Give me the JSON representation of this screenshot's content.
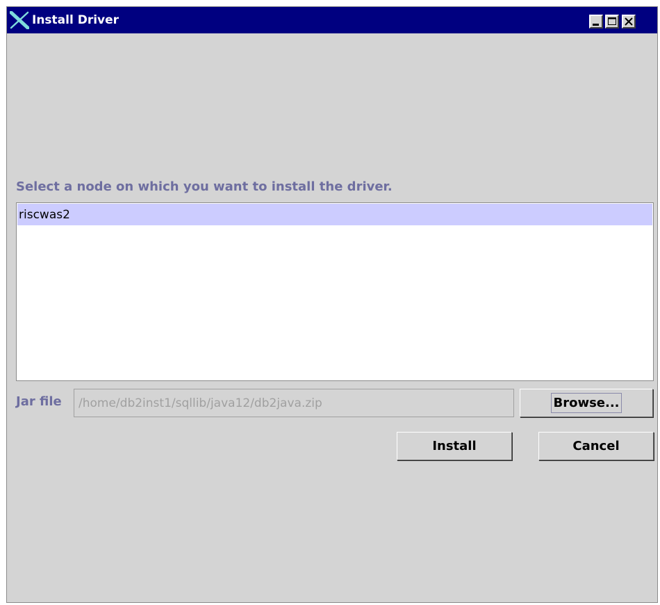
{
  "window": {
    "title": "Install Driver"
  },
  "title_buttons": {
    "minimize_icon": "minimize-icon",
    "maximize_icon": "maximize-icon",
    "close_icon": "close-icon"
  },
  "instruction": "Select a node on which you want to install the driver.",
  "nodes": [
    {
      "label": "riscwas2",
      "selected": true
    }
  ],
  "jar": {
    "label": "Jar file",
    "value": "/home/db2inst1/sqllib/java12/db2java.zip"
  },
  "buttons": {
    "browse": "Browse...",
    "install": "Install",
    "cancel": "Cancel"
  },
  "colors": {
    "titlebar": "#000080",
    "selection": "#ccccff",
    "label_text": "#6e6ea0",
    "window_bg": "#d4d4d4"
  }
}
